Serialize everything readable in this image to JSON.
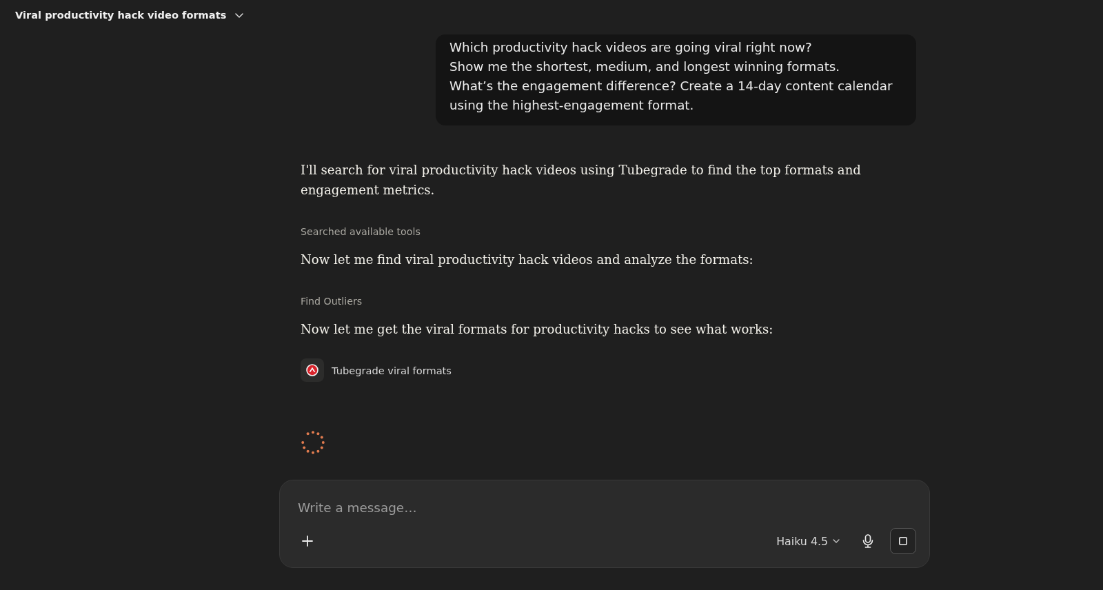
{
  "header": {
    "title": "Viral productivity hack video formats"
  },
  "user_message": {
    "paragraphs": [
      "Which productivity hack videos are going viral right now?",
      "Show me the shortest, medium, and longest winning formats.",
      "What’s the engagement difference? Create a 14-day content calendar using the highest-engagement format."
    ]
  },
  "assistant": {
    "blocks": [
      {
        "kind": "text",
        "text": "I'll search for viral productivity hack videos using Tubegrade to find the top formats and engagement metrics."
      },
      {
        "kind": "step",
        "text": "Searched available tools"
      },
      {
        "kind": "text",
        "text": "Now let me find viral productivity hack videos and analyze the formats:"
      },
      {
        "kind": "step",
        "text": "Find Outliers"
      },
      {
        "kind": "text",
        "text": "Now let me get the viral formats for productivity hacks to see what works:"
      },
      {
        "kind": "tool_call",
        "text": "Tubegrade viral formats"
      }
    ],
    "loading": true
  },
  "composer": {
    "placeholder": "Write a message…",
    "model": "Haiku 4.5"
  }
}
